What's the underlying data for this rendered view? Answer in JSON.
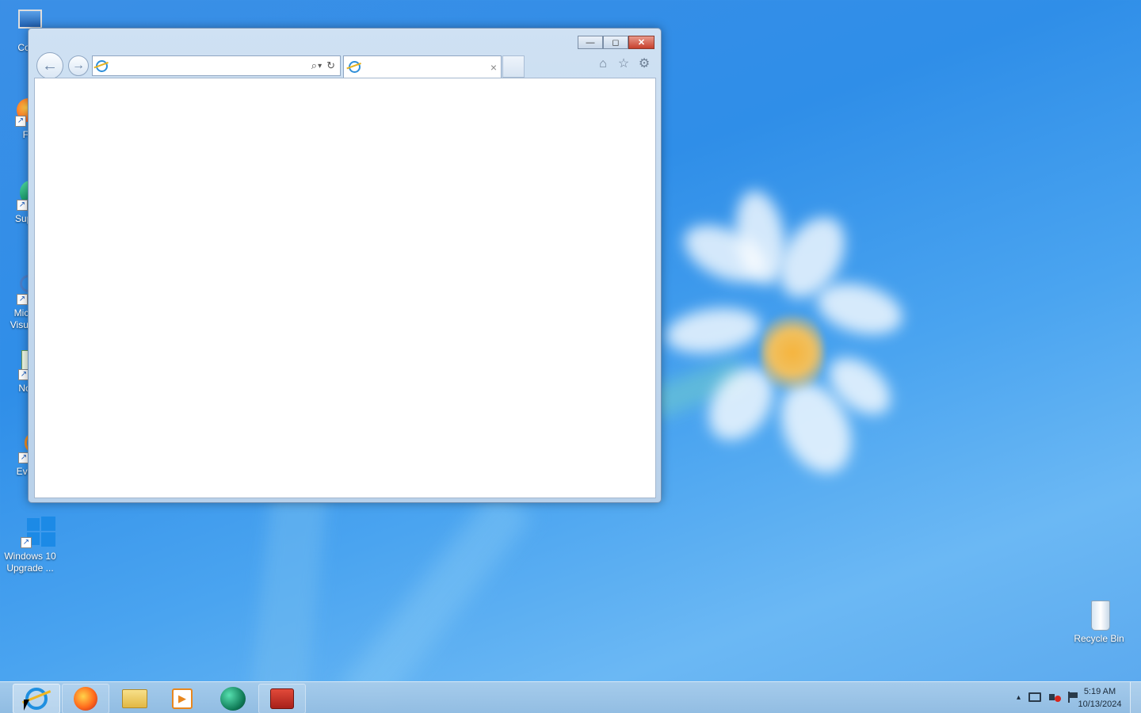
{
  "desktop": {
    "icons": [
      {
        "label": "Com",
        "icon": "computer-icon"
      },
      {
        "label": "Fire",
        "icon": "firefox-icon"
      },
      {
        "label": "Super",
        "icon": "super-app-icon"
      },
      {
        "label": "Micr Visual",
        "icon": "visual-studio-icon"
      },
      {
        "label": "Note",
        "icon": "notepad-icon"
      },
      {
        "label": "Every",
        "icon": "everything-search-icon"
      },
      {
        "label": "Windows 10 Upgrade ...",
        "icon": "windows-logo-icon"
      }
    ],
    "recycle_bin": {
      "label": "Recycle Bin",
      "icon": "recycle-bin-icon"
    }
  },
  "browser": {
    "address_value": "",
    "tab_title": "",
    "controls": {
      "minimize": "—",
      "restore": "◻",
      "close": "✕"
    },
    "nav": {
      "back": "←",
      "forward": "→"
    },
    "tools": {
      "search": "⌕",
      "dropdown": "▾",
      "refresh": "↻",
      "tab_close": "×"
    },
    "command_icons": {
      "home": "⌂",
      "favorites": "☆",
      "settings": "⚙"
    }
  },
  "taskbar": {
    "apps": [
      {
        "name": "internet-explorer",
        "state": "active"
      },
      {
        "name": "firefox",
        "state": "open"
      },
      {
        "name": "file-explorer",
        "state": "pinned"
      },
      {
        "name": "media-player",
        "state": "pinned"
      },
      {
        "name": "super-app",
        "state": "pinned"
      },
      {
        "name": "toolbox-app",
        "state": "open"
      }
    ],
    "tray": {
      "chevron": "▴"
    },
    "time": "5:19 AM",
    "date": "10/13/2024"
  },
  "colors": {
    "accent": "#2f8ee8",
    "close_red": "#c7402d"
  }
}
